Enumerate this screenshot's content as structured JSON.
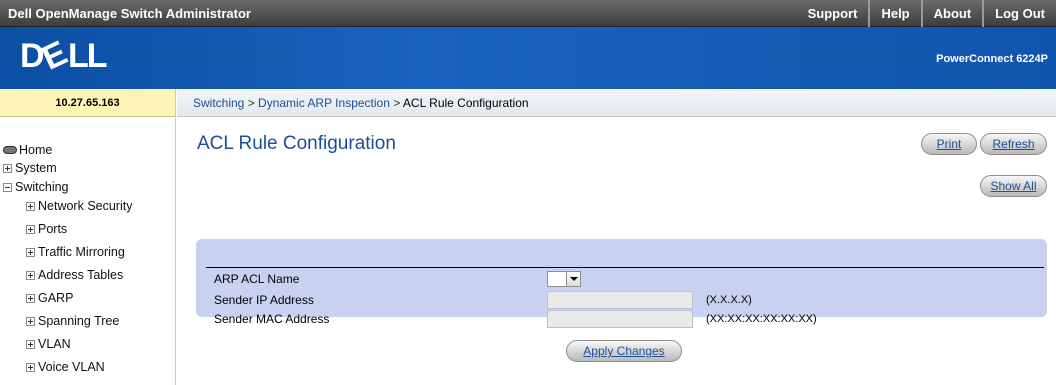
{
  "topbar": {
    "title": "Dell OpenManage Switch Administrator",
    "links": [
      "Support",
      "Help",
      "About",
      "Log Out"
    ]
  },
  "header": {
    "logo_text": "DELL",
    "model": "PowerConnect 6224P"
  },
  "ip_address": "10.27.65.163",
  "breadcrumb": {
    "items": [
      "Switching",
      "Dynamic ARP Inspection",
      "ACL Rule Configuration"
    ],
    "separator": ">"
  },
  "sidebar": {
    "items": [
      {
        "label": "Home",
        "icon": "home-icon",
        "level": 0
      },
      {
        "label": "System",
        "icon": "expand-plus-icon",
        "level": 0
      },
      {
        "label": "Switching",
        "icon": "collapse-minus-icon",
        "level": 0
      },
      {
        "label": "Network Security",
        "icon": "expand-plus-icon",
        "level": 1
      },
      {
        "label": "Ports",
        "icon": "expand-plus-icon",
        "level": 1
      },
      {
        "label": "Traffic Mirroring",
        "icon": "expand-plus-icon",
        "level": 1
      },
      {
        "label": "Address Tables",
        "icon": "expand-plus-icon",
        "level": 1
      },
      {
        "label": "GARP",
        "icon": "expand-plus-icon",
        "level": 1
      },
      {
        "label": "Spanning Tree",
        "icon": "expand-plus-icon",
        "level": 1
      },
      {
        "label": "VLAN",
        "icon": "expand-plus-icon",
        "level": 1
      },
      {
        "label": "Voice VLAN",
        "icon": "expand-plus-icon",
        "level": 1
      }
    ]
  },
  "main": {
    "title": "ACL Rule Configuration",
    "buttons": {
      "print": "Print",
      "refresh": "Refresh",
      "show_all": "Show All",
      "apply": "Apply Changes"
    },
    "form": {
      "rows": [
        {
          "label": "ARP ACL Name",
          "type": "select",
          "value": ""
        },
        {
          "label": "Sender IP Address",
          "type": "text",
          "value": "",
          "format": "(X.X.X.X)"
        },
        {
          "label": "Sender MAC Address",
          "type": "text",
          "value": "",
          "format": "(XX:XX:XX:XX:XX:XX)"
        }
      ]
    }
  },
  "colors": {
    "topbar": "#4a4a4a",
    "header_blue": "#0f55ad",
    "link_blue": "#1b4f97",
    "ip_box": "#fdf4b6",
    "panel": "#c8d2f0"
  }
}
